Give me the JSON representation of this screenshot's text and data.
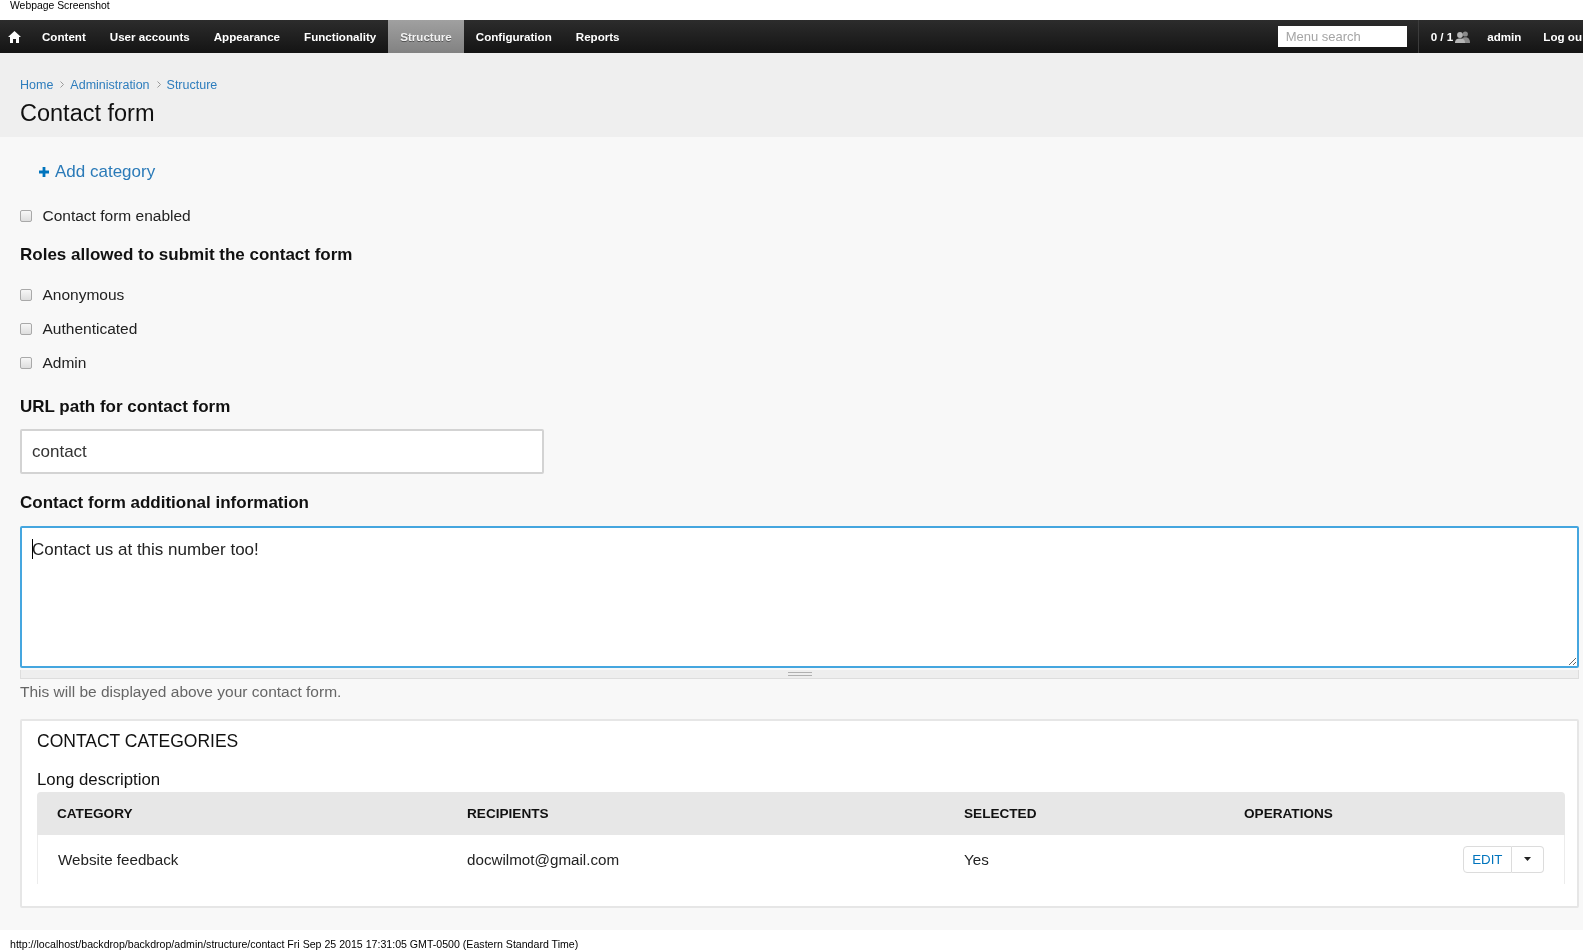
{
  "caption": "Webpage Screenshot",
  "toolbar": {
    "items": [
      {
        "kind": "home",
        "selected": false
      },
      {
        "kind": "link",
        "label": "Content",
        "selected": false
      },
      {
        "kind": "link",
        "label": "User accounts",
        "selected": false
      },
      {
        "kind": "link",
        "label": "Appearance",
        "selected": false
      },
      {
        "kind": "link",
        "label": "Functionality",
        "selected": false
      },
      {
        "kind": "link",
        "label": "Structure",
        "selected": true
      },
      {
        "kind": "link",
        "label": "Configuration",
        "selected": false
      },
      {
        "kind": "link",
        "label": "Reports",
        "selected": false
      }
    ],
    "search": {
      "placeholder": "Menu search"
    },
    "online_count": "0 / 1",
    "user": "admin",
    "logout": "Log ou"
  },
  "breadcrumb": [
    "Home",
    "Administration",
    "Structure"
  ],
  "title": "Contact form",
  "form": {
    "add_link": "Add category",
    "enabled": {
      "label": "Contact form enabled",
      "checked": false
    },
    "roles": {
      "heading": "Roles allowed to submit the contact form",
      "options": [
        {
          "label": "Anonymous",
          "checked": false
        },
        {
          "label": "Authenticated",
          "checked": false
        },
        {
          "label": "Admin",
          "checked": false
        }
      ]
    },
    "url_path": {
      "label": "URL path for contact form",
      "value": "contact"
    },
    "additional_info": {
      "label": "Contact form additional information",
      "value": "Contact us at this number too!",
      "focused": true,
      "description": "This will be displayed above your contact form."
    }
  },
  "categories": {
    "title": "CONTACT CATEGORIES",
    "description": "Long description",
    "table": {
      "columns": [
        "CATEGORY",
        "RECIPIENTS",
        "SELECTED",
        "OPERATIONS"
      ],
      "rows": [
        {
          "cells": [
            "Website feedback",
            "docwilmot@gmail.com",
            "Yes"
          ],
          "operation": "EDIT"
        }
      ]
    }
  },
  "status_bar": "http://localhost/backdrop/backdrop/admin/structure/contact Fri Sep 25 2015 17:31:05 GMT-0500 (Eastern Standard Time)"
}
